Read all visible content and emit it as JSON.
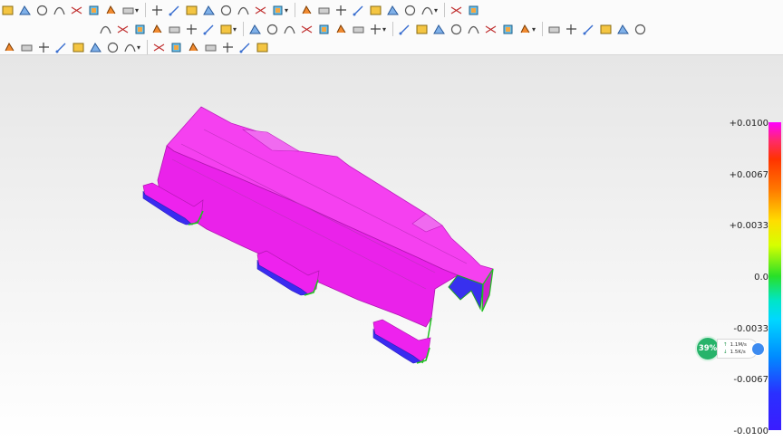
{
  "toolbar": {
    "rows": [
      {
        "icons": [
          "curve-tools-icon",
          "sketch-circle-icon",
          "offset-curve-icon",
          "trim-curve-icon",
          "split-curve-icon",
          "grid-icon",
          "intersect-curve-icon",
          "extend-curve-icon",
          "fillet-curve-icon",
          "blend-curve-icon",
          "surface-curve-icon",
          "isoparm-icon",
          "measure-curve-icon",
          "curve-analysis-icon",
          "point-icon",
          "wire-icon",
          "curve-network-icon",
          "spiral-icon",
          "project-curve-icon",
          "deviation-icon",
          "view-icon",
          "section-icon",
          "render-icon",
          "surface-analysis-icon",
          "compare-icon",
          "ruler-icon"
        ]
      },
      {
        "icons": [
          "rectangle-icon",
          "extrude-icon",
          "revolve-icon",
          "sweep-icon",
          "loft-icon",
          "shell-icon",
          "blend-surface-icon",
          "patch-icon",
          "boundary-surface-icon",
          "offset-surface-icon",
          "thicken-icon",
          "split-body-icon",
          "trim-body-icon",
          "unite-icon",
          "subtract-icon",
          "intersect-body-icon",
          "fillet-surface-icon",
          "chamfer-icon",
          "box-icon",
          "cylinder-icon",
          "sphere-icon",
          "cone-icon",
          "torus-icon",
          "wedge-icon",
          "plane-icon",
          "mesh-icon",
          "wrap-icon",
          "morph-icon",
          "shape-icon",
          "body-icon"
        ]
      },
      {
        "icons": [
          "view-cube-icon",
          "snap-point-icon",
          "snap-line-icon",
          "snap-edge-icon",
          "snap-curve-icon",
          "snap-spline-icon",
          "snap-tangent-icon",
          "snap-center-icon",
          "snap-circle-icon",
          "snap-cross-icon",
          "snap-angle-icon",
          "snap-grid-icon",
          "snap-vertex-icon",
          "move-icon",
          "layer-icon"
        ]
      }
    ]
  },
  "viewport": {
    "background": "#f0f0f0",
    "model_color": "#ff00ff"
  },
  "legend": {
    "labels": [
      "+0.0100",
      "+0.0067",
      "+0.0033",
      "0.0",
      "-0.0033",
      "-0.0067",
      "-0.0100"
    ],
    "colors": {
      "top": "#ff00ff",
      "mid": "#28e028",
      "bottom": "#3a1cff"
    }
  },
  "network_widget": {
    "percent": "39%",
    "upload": "1.1M/s",
    "download": "1.5K/s"
  }
}
